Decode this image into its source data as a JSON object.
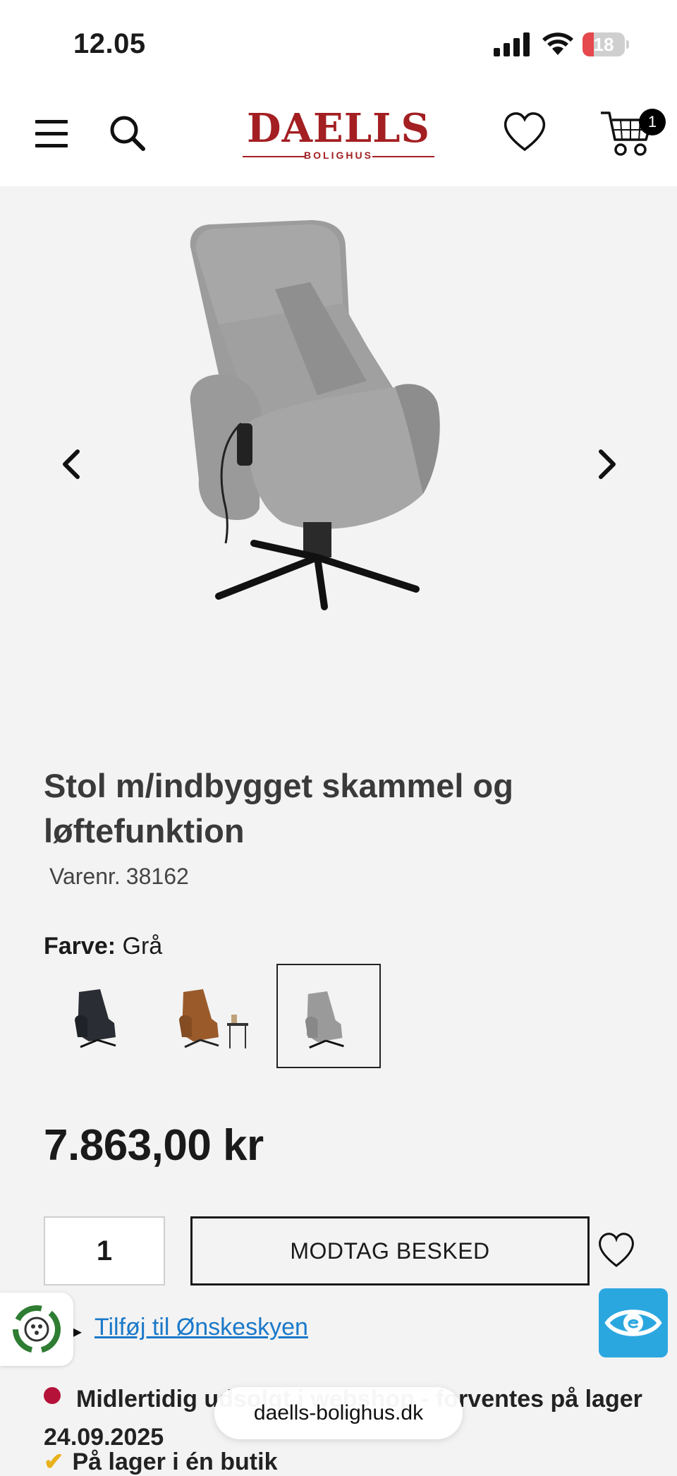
{
  "status_bar": {
    "time": "12.05",
    "battery": "18"
  },
  "header": {
    "logo_brand": "DAELLS",
    "logo_sub": "BOLIGHUS",
    "cart_count": "1"
  },
  "product": {
    "title": "Stol m/indbygget skammel og løftefunktion",
    "sku_label": "Varenr.",
    "sku": "38162",
    "color_label": "Farve:",
    "color_value": "Grå",
    "swatches": [
      "black",
      "cognac",
      "grey"
    ],
    "price": "7.863,00 kr",
    "quantity": "1",
    "notify_label": "MODTAG BESKED",
    "wishlist_link": "Tilføj til Ønskeskyen",
    "stock_text": "Midlertidig udsolgt i webshop - forventes på lager 24.09.2025",
    "store_stock": "På lager i én butik"
  },
  "browser": {
    "url": "daells-bolighus.dk"
  },
  "colors": {
    "brand": "#a31f22",
    "link": "#1b79c9",
    "accessibility": "#2ba7e0",
    "out_of_stock": "#b5123a"
  }
}
